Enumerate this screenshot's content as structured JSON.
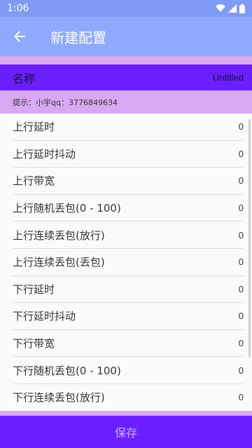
{
  "status_bar": {
    "time": "1:06"
  },
  "app_bar": {
    "title": "新建配置"
  },
  "name_row": {
    "label": "名称",
    "value": "Untitled"
  },
  "hint": "提示：小宇qq：3776849634",
  "items": [
    {
      "label": "上行延时",
      "value": "0"
    },
    {
      "label": "上行延时抖动",
      "value": "0"
    },
    {
      "label": "上行带宽",
      "value": "0"
    },
    {
      "label": "上行随机丢包(0 - 100)",
      "value": "0"
    },
    {
      "label": "上行连续丢包(放行)",
      "value": "0"
    },
    {
      "label": "上行连续丢包(丢包)",
      "value": "0"
    },
    {
      "label": "下行延时",
      "value": "0"
    },
    {
      "label": "下行延时抖动",
      "value": "0"
    },
    {
      "label": "下行带宽",
      "value": "0"
    },
    {
      "label": "下行随机丢包(0 - 100)",
      "value": "0"
    },
    {
      "label": "下行连续丢包(放行)",
      "value": "0"
    }
  ],
  "save_label": "保存",
  "icons": {
    "back": "arrow-back-icon",
    "wifi": "wifi-icon",
    "signal": "signal-icon",
    "battery": "battery-icon"
  }
}
